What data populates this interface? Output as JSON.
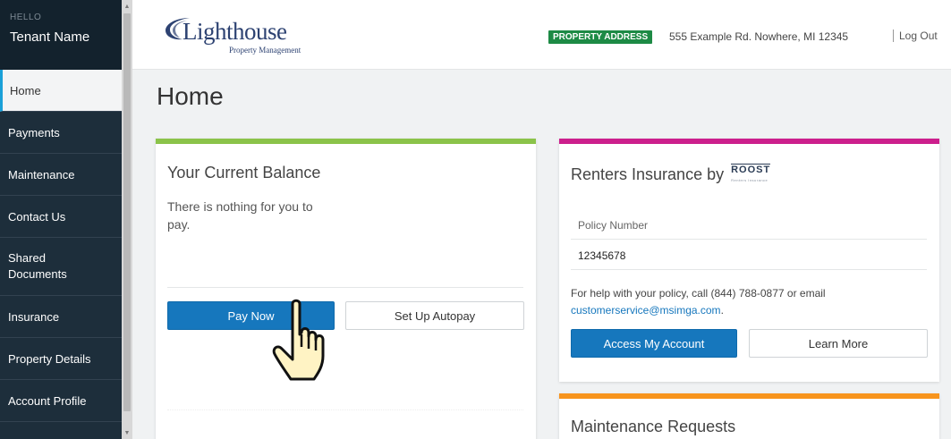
{
  "sidebar": {
    "greeting": "HELLO",
    "tenant_name": "Tenant Name",
    "items": [
      {
        "label": "Home"
      },
      {
        "label": "Payments"
      },
      {
        "label": "Maintenance"
      },
      {
        "label": "Contact Us"
      },
      {
        "label": "Shared Documents"
      },
      {
        "label": "Insurance"
      },
      {
        "label": "Property Details"
      },
      {
        "label": "Account Profile"
      }
    ]
  },
  "header": {
    "logo_main": "Lighthouse",
    "logo_sub": "Property Management",
    "property_badge": "PROPERTY ADDRESS",
    "property_address": "555 Example Rd. Nowhere, MI 12345",
    "logout_label": "Log Out"
  },
  "page": {
    "title": "Home"
  },
  "balance_card": {
    "title": "Your Current Balance",
    "message": "There is nothing for you to pay.",
    "pay_now_label": "Pay Now",
    "autopay_label": "Set Up Autopay"
  },
  "insurance_card": {
    "title": "Renters Insurance by",
    "brand": "ROOST",
    "brand_sub": "Renters Insurance",
    "policy_label": "Policy Number",
    "policy_number": "12345678",
    "help_text": "For help with your policy, call (844) 788-0877 or email",
    "help_email": "customerservice@msimga.com",
    "help_suffix": ".",
    "access_label": "Access My Account",
    "learn_label": "Learn More"
  },
  "maintenance_card": {
    "title": "Maintenance Requests"
  },
  "colors": {
    "sidebar_bg": "#1d2e3b",
    "primary_button": "#1677bd",
    "balance_accent": "#8bc34a",
    "insurance_accent": "#cc1f8c",
    "maintenance_accent": "#f7941d",
    "badge_green": "#1d8a45"
  }
}
